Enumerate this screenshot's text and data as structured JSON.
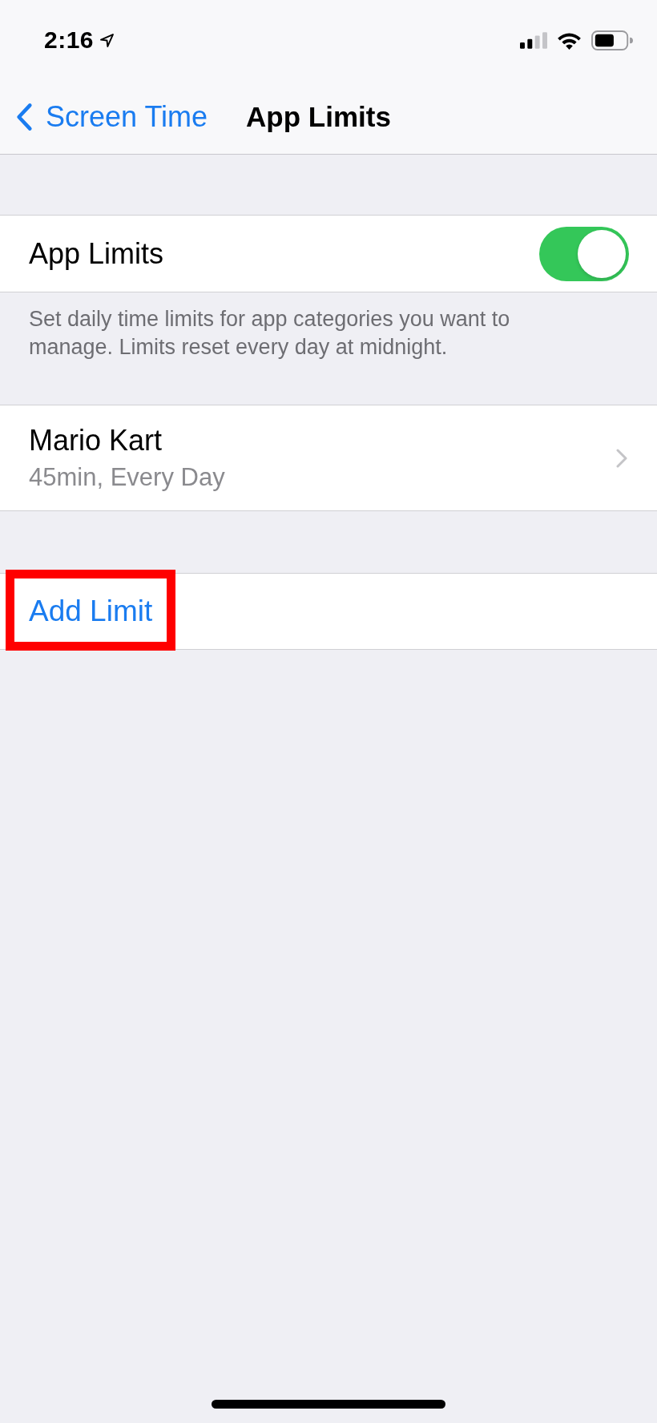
{
  "status_bar": {
    "time": "2:16"
  },
  "nav_bar": {
    "back_label": "Screen Time",
    "title": "App Limits"
  },
  "app_limits": {
    "label": "App Limits",
    "on": true,
    "footer": "Set daily time limits for app categories you want to manage. Limits reset every day at midnight."
  },
  "limits": [
    {
      "name": "Mario Kart",
      "detail": "45min, Every Day"
    }
  ],
  "add_limit": {
    "label": "Add Limit",
    "highlighted": true
  }
}
